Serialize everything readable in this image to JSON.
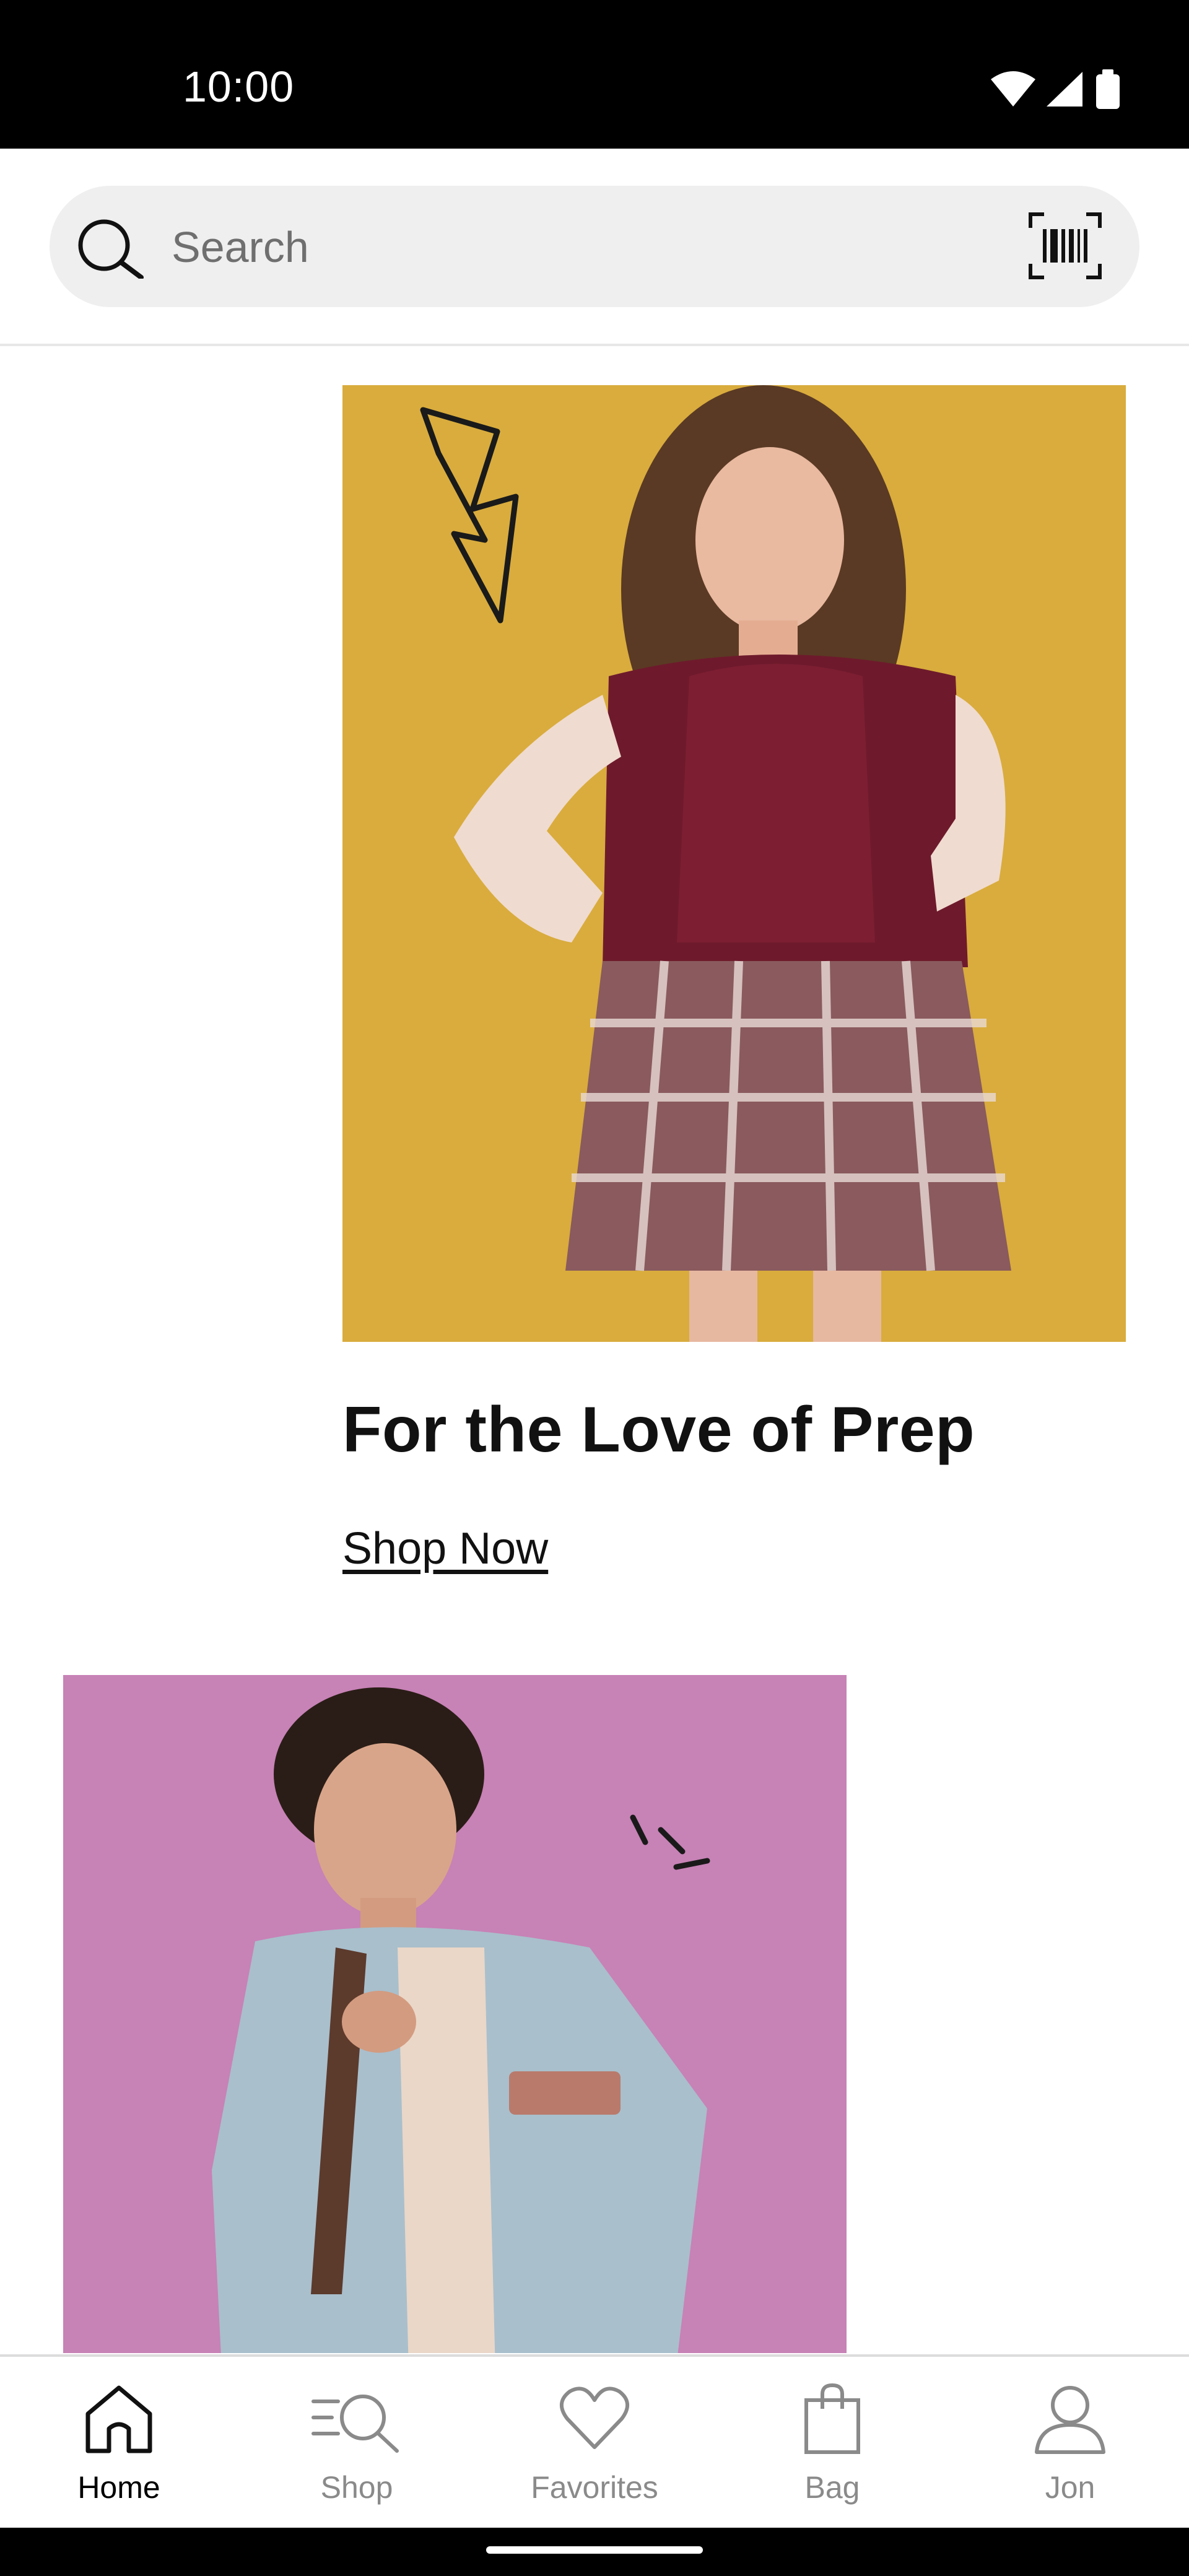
{
  "status_bar": {
    "time": "10:00"
  },
  "search": {
    "placeholder": "Search",
    "search_icon": "search-icon",
    "barcode_icon": "barcode-scan-icon"
  },
  "promos": [
    {
      "title": "For the Love of Prep",
      "link_label": "Shop Now",
      "background_color": "#d9ac3d"
    },
    {
      "background_color": "#c782b6"
    }
  ],
  "bottom_nav": {
    "items": [
      {
        "label": "Home",
        "icon": "home-icon",
        "active": true
      },
      {
        "label": "Shop",
        "icon": "shop-search-icon",
        "active": false
      },
      {
        "label": "Favorites",
        "icon": "heart-icon",
        "active": false
      },
      {
        "label": "Bag",
        "icon": "bag-icon",
        "active": false
      },
      {
        "label": "Jon",
        "icon": "person-icon",
        "active": false
      }
    ]
  }
}
